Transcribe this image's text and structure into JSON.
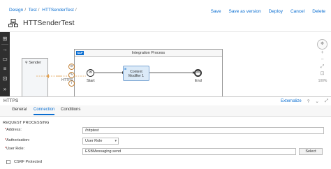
{
  "breadcrumb": [
    "Design",
    "Test",
    "HTTSenderTest"
  ],
  "breadcrumb_sep": "/",
  "page_title": "HTTSenderTest",
  "header_actions": {
    "save": "Save",
    "save_as_version": "Save as version",
    "deploy": "Deploy",
    "cancel": "Cancel",
    "delete": "Delete"
  },
  "canvas": {
    "sender_label": "Sender",
    "integration_process_label": "Integration Process",
    "sap_logo": "SAP",
    "adapter_label": "HTTPS",
    "start_label": "Start",
    "content_modifier_label": "Content Modifier 1",
    "end_label": "End",
    "zoom_percent": "100%"
  },
  "panel": {
    "title": "HTTPS",
    "externalize": "Externalize",
    "tabs": [
      "General",
      "Connection",
      "Conditions"
    ],
    "active_tab": "Connection",
    "section_title": "REQUEST PROCESSING",
    "address_label": "Address:",
    "address_value": "/httptest",
    "authorization_label": "Authorization:",
    "authorization_value": "User Role",
    "user_role_label": "User Role:",
    "user_role_value": "ESBMessaging.send",
    "select_button": "Select",
    "csrf_label": "CSRF Protected",
    "csrf_checked": false
  },
  "colors": {
    "accent": "#0a6ed1",
    "toolbar": "#2f2f2f"
  }
}
